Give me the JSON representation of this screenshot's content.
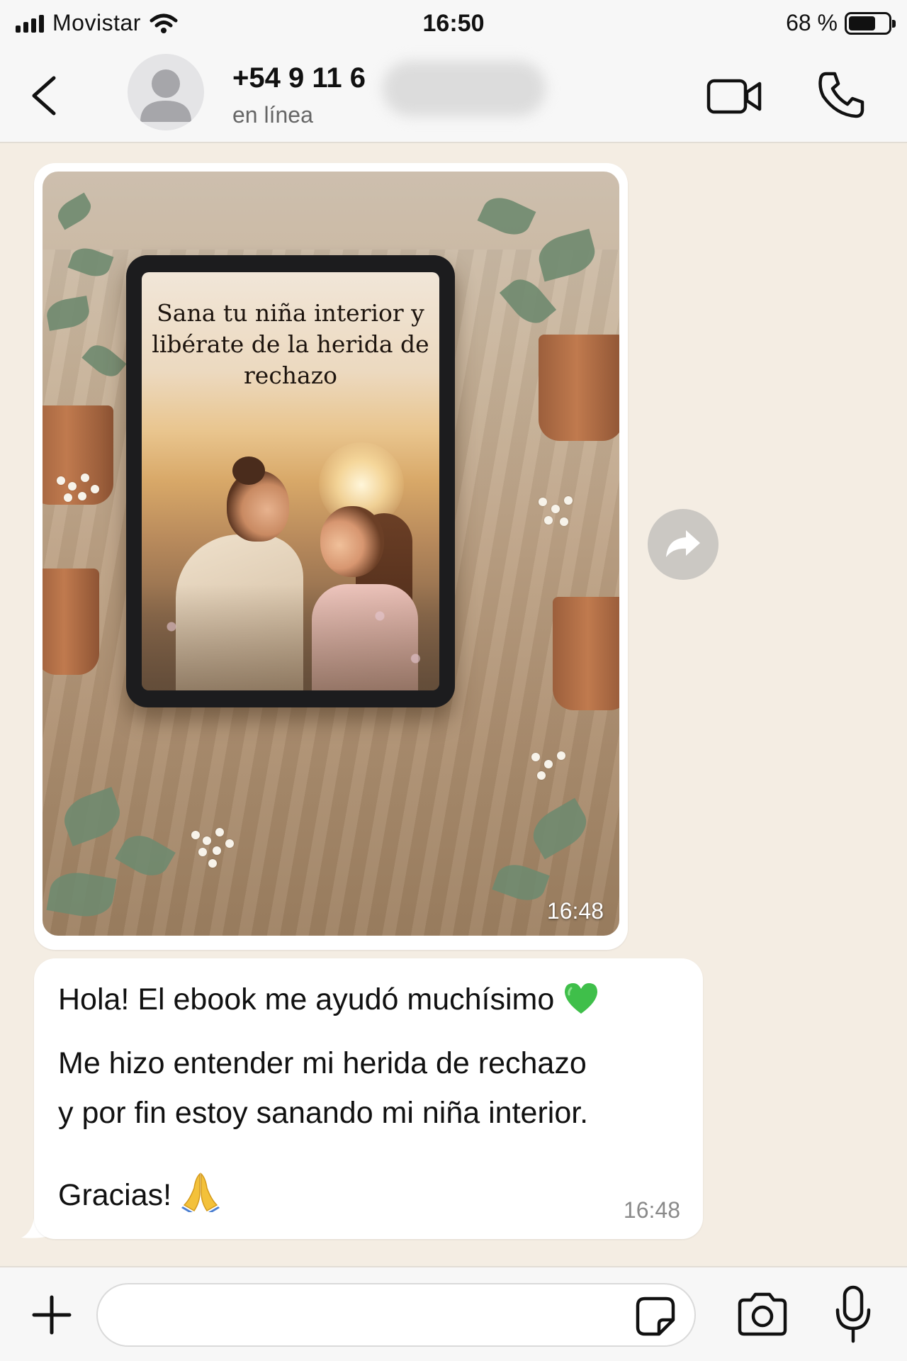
{
  "status_bar": {
    "carrier": "Movistar",
    "time": "16:50",
    "battery_percent": "68 %",
    "battery_level": 0.68,
    "icons": [
      "signal-icon",
      "wifi-icon",
      "battery-icon"
    ]
  },
  "header": {
    "contact_name": "+54 9 11 6",
    "contact_status": "en línea",
    "icons": [
      "back-icon",
      "avatar-placeholder-icon",
      "video-call-icon",
      "phone-icon"
    ]
  },
  "messages": [
    {
      "type": "image",
      "image_text": "Sana tu niña interior y libérate de la herida de rechazo",
      "time": "16:48"
    },
    {
      "type": "text",
      "lines": [
        "Hola! El ebook me ayudó muchísimo",
        "Me hizo entender mi herida de rechazo",
        "y por fin estoy sanando mi niña interior.",
        "Gracias!"
      ],
      "emojis": [
        "green-heart-icon",
        "folded-hands-icon"
      ],
      "time": "16:48"
    }
  ],
  "input_bar": {
    "placeholder": "",
    "icons": [
      "plus-icon",
      "sticker-icon",
      "camera-icon",
      "microphone-icon"
    ]
  },
  "colors": {
    "chat_background": "#f4ede3",
    "bar_background": "#f7f7f7",
    "bubble": "#ffffff",
    "accent_heart": "#3fbf4a"
  }
}
